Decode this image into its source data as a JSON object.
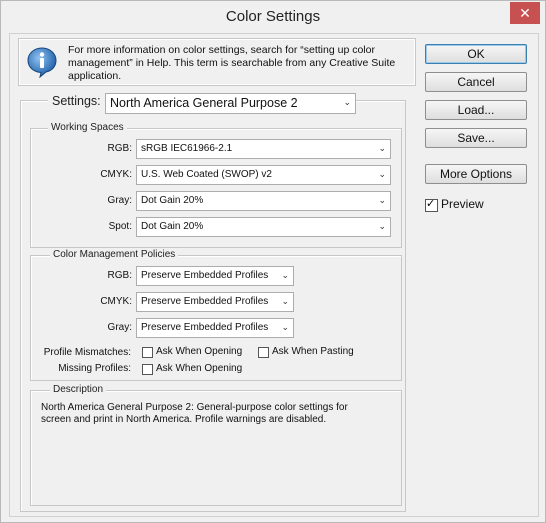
{
  "window": {
    "title": "Color Settings"
  },
  "info": {
    "text": "For more information on color settings, search for “setting up color management” in Help. This term is searchable from any Creative Suite application."
  },
  "buttons": {
    "ok": "OK",
    "cancel": "Cancel",
    "load": "Load...",
    "save": "Save...",
    "more_options": "More Options"
  },
  "preview": {
    "label": "Preview",
    "checked": true
  },
  "settings": {
    "label": "Settings:",
    "value": "North America General Purpose 2"
  },
  "working_spaces": {
    "legend": "Working Spaces",
    "rgb_label": "RGB:",
    "rgb_value": "sRGB IEC61966-2.1",
    "cmyk_label": "CMYK:",
    "cmyk_value": "U.S. Web Coated (SWOP) v2",
    "gray_label": "Gray:",
    "gray_value": "Dot Gain 20%",
    "spot_label": "Spot:",
    "spot_value": "Dot Gain 20%"
  },
  "policies": {
    "legend": "Color Management Policies",
    "rgb_label": "RGB:",
    "rgb_value": "Preserve Embedded Profiles",
    "cmyk_label": "CMYK:",
    "cmyk_value": "Preserve Embedded Profiles",
    "gray_label": "Gray:",
    "gray_value": "Preserve Embedded Profiles",
    "mismatch_label": "Profile Mismatches:",
    "ask_opening": "Ask When Opening",
    "ask_pasting": "Ask When Pasting",
    "missing_label": "Missing Profiles:",
    "ask_opening_missing": "Ask When Opening"
  },
  "description": {
    "legend": "Description",
    "text": "North America General Purpose 2:  General-purpose color settings for screen and print in North America. Profile warnings are disabled."
  },
  "icons": {
    "info": "info-icon",
    "close": "close-icon",
    "dropdown": "chevron-down-icon"
  }
}
